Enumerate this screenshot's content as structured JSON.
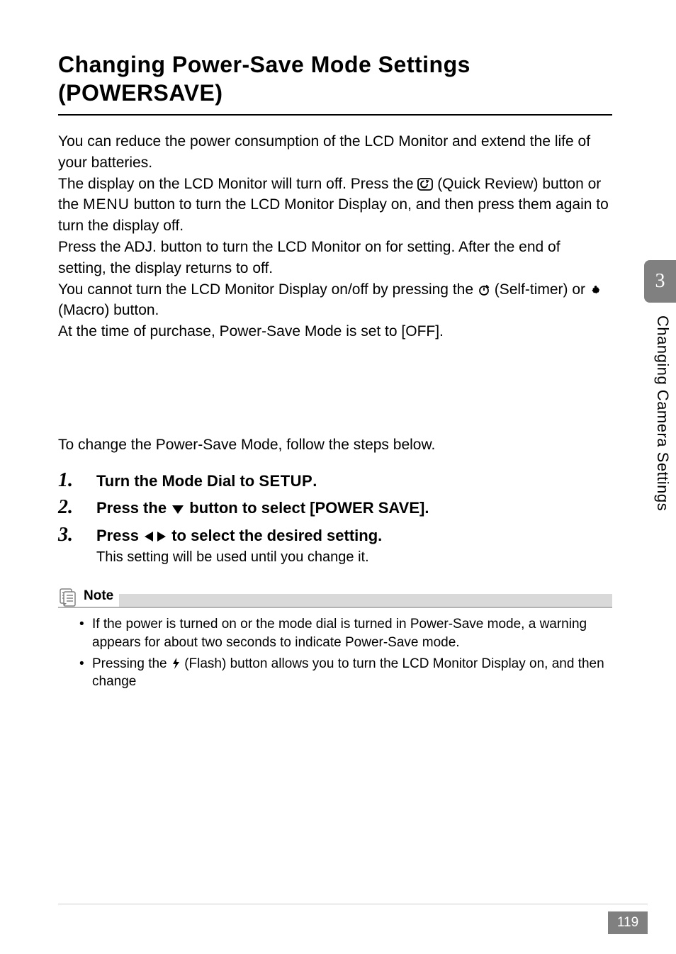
{
  "heading": "Changing Power-Save Mode Settings (POWERSAVE)",
  "intro": {
    "p1": "You can reduce the power consumption of the LCD Monitor and extend the life of your batteries.",
    "p2a": "The display on the LCD Monitor will turn off. Press the ",
    "p2b": " (Quick Review) button or the ",
    "menu": "MENU",
    "p2c": " button to turn the LCD Monitor Display on, and then press them again to turn the display off.",
    "p3": "Press the ADJ. button to turn the LCD Monitor on for setting. After the end of setting, the display returns to off.",
    "p4a": "You cannot turn the LCD Monitor Display on/off by pressing the ",
    "p4b": " (Self-timer) or ",
    "p4c": " (Macro) button.",
    "p5": "At the time of purchase, Power-Save Mode is set to [OFF]."
  },
  "lead": "To change the Power-Save Mode, follow the steps below.",
  "steps": [
    {
      "pre": "Turn the Mode Dial to ",
      "setup": "SETUP",
      "post": "."
    },
    {
      "pre": "Press the ",
      "mid": " button to select [POWER SAVE]."
    },
    {
      "pre": "Press ",
      "mid": " to select the desired setting.",
      "body": "This setting will be used until you change it."
    }
  ],
  "note": {
    "label": "Note",
    "items": [
      {
        "text": "If the power is turned on or the mode dial is turned in Power-Save mode, a warning appears for about two seconds to indicate Power-Save mode."
      },
      {
        "pre": "Pressing the ",
        "post": " (Flash) button allows you to turn the LCD Monitor Display on, and then change"
      }
    ]
  },
  "side": {
    "chapter": "3",
    "label": "Changing Camera Settings"
  },
  "page_number": "119"
}
